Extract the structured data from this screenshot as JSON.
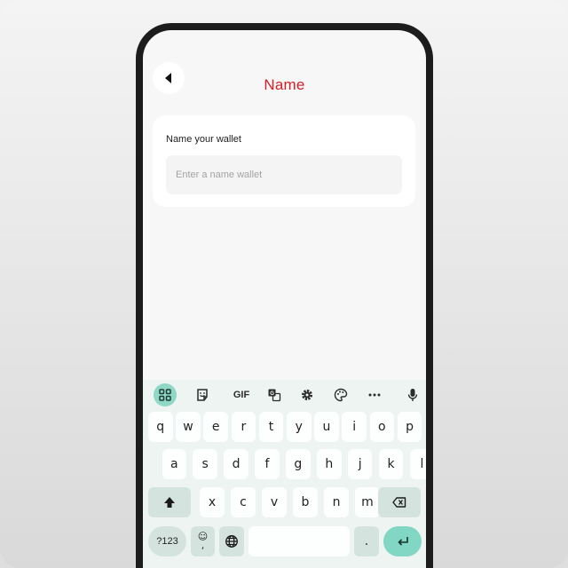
{
  "header": {
    "title": "Name"
  },
  "form": {
    "label": "Name your wallet",
    "placeholder": "Enter a name wallet",
    "value": ""
  },
  "keyboard": {
    "toolbar": {
      "gif_label": "GIF"
    },
    "rows": [
      [
        "q",
        "w",
        "e",
        "r",
        "t",
        "y",
        "u",
        "i",
        "o",
        "p"
      ],
      [
        "a",
        "s",
        "d",
        "f",
        "g",
        "h",
        "j",
        "k",
        "l"
      ],
      [
        "x",
        "c",
        "v",
        "b",
        "n",
        "m"
      ]
    ],
    "symbols_label": "?123",
    "comma_label": ",",
    "emoji_glyph": "☺",
    "period_label": ".",
    "accent_color": "#82d6c4"
  },
  "colors": {
    "title": "#d32027"
  }
}
